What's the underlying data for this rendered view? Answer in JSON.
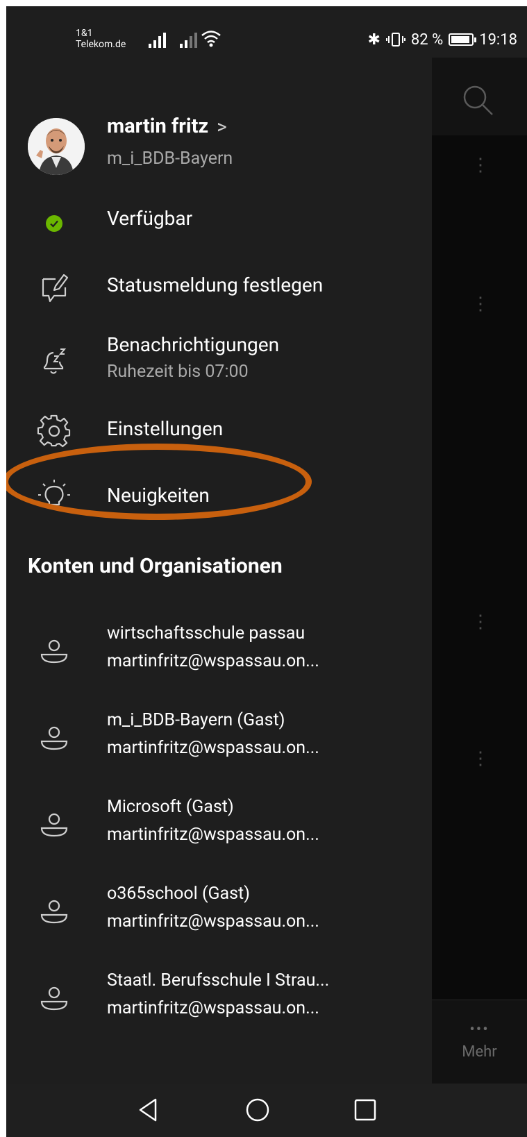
{
  "status_bar": {
    "carrier_line1": "1&1",
    "carrier_line2": "Telekom.de",
    "battery_percent": "82 %",
    "time": "19:18"
  },
  "profile": {
    "name": "martin fritz",
    "chevron": ">",
    "organization": "m_i_BDB-Bayern"
  },
  "menu": {
    "status_label": "Verfügbar",
    "status_message_label": "Statusmeldung festlegen",
    "notifications_label": "Benachrichtigungen",
    "notifications_sub": "Ruhezeit bis 07:00",
    "settings_label": "Einstellungen",
    "news_label": "Neuigkeiten"
  },
  "accounts_section": {
    "header": "Konten und Organisationen",
    "items": [
      {
        "name": "wirtschaftsschule passau",
        "email": "martinfritz@wspassau.on..."
      },
      {
        "name": "m_i_BDB-Bayern (Gast)",
        "email": "martinfritz@wspassau.on..."
      },
      {
        "name": "Microsoft (Gast)",
        "email": "martinfritz@wspassau.on..."
      },
      {
        "name": "o365school (Gast)",
        "email": "martinfritz@wspassau.on..."
      },
      {
        "name": "Staatl. Berufsschule I Strau...",
        "email": "martinfritz@wspassau.on..."
      }
    ]
  },
  "background_app": {
    "more_dots": "•••",
    "more_label": "Mehr"
  },
  "colors": {
    "drawer_bg": "#1e1e1e",
    "available_green": "#6bb700",
    "highlight_orange": "#c8600e"
  }
}
